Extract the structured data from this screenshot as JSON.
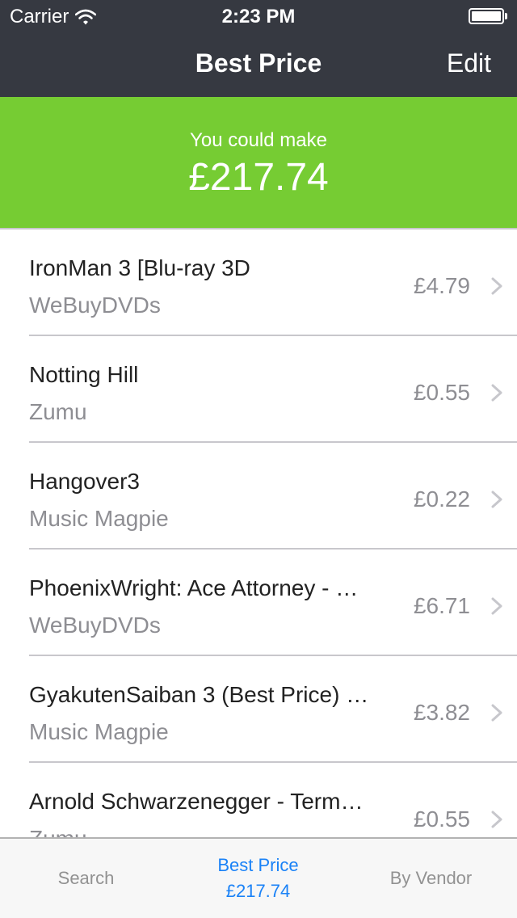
{
  "status_bar": {
    "carrier": "Carrier",
    "time": "2:23 PM",
    "signal_icon": "wifi-icon",
    "battery_icon": "battery-icon",
    "battery_level": 1.0
  },
  "nav": {
    "title": "Best Price",
    "edit_label": "Edit"
  },
  "summary": {
    "label": "You could make",
    "amount": "£217.74",
    "color": "#76cc33"
  },
  "items": [
    {
      "title": "IronMan 3 [Blu-ray 3D",
      "vendor": "WeBuyDVDs",
      "price": "£4.79"
    },
    {
      "title": "Notting Hill",
      "vendor": "Zumu",
      "price": "£0.55"
    },
    {
      "title": "Hangover3",
      "vendor": "Music Magpie",
      "price": "£0.22"
    },
    {
      "title": "PhoenixWright: Ace Attorney - …",
      "vendor": "WeBuyDVDs",
      "price": "£6.71"
    },
    {
      "title": "GyakutenSaiban 3 (Best Price) …",
      "vendor": "Music Magpie",
      "price": "£3.82"
    },
    {
      "title": "Arnold Schwarzenegger - Term…",
      "vendor": "Zumu",
      "price": "£0.55"
    }
  ],
  "tab_bar": {
    "search_label": "Search",
    "best_price_label": "Best Price",
    "best_price_amount": "£217.74",
    "by_vendor_label": "By Vendor",
    "active_color": "#1a82f7"
  }
}
